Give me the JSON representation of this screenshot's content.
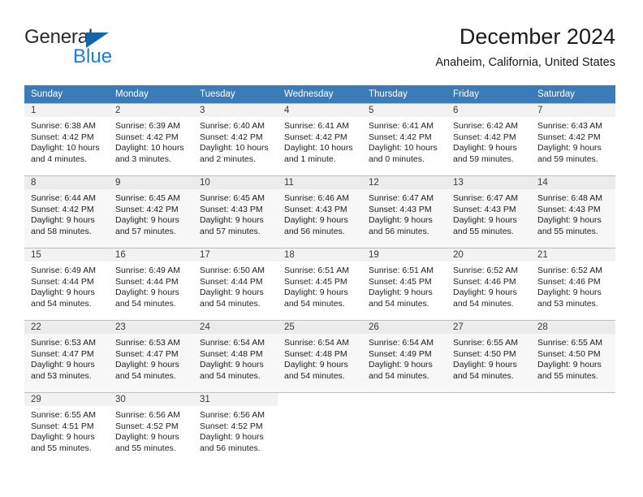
{
  "logo": {
    "primary_text": "General",
    "secondary_text": "Blue",
    "primary_color": "#2b2b2b",
    "secondary_color": "#1b7ed0",
    "triangle_color": "#1464ad"
  },
  "header": {
    "title": "December 2024",
    "subtitle": "Anaheim, California, United States"
  },
  "theme": {
    "header_row_bg": "#3b7cb8",
    "header_row_text": "#ffffff",
    "alt_row_bg": "#f7f7f7",
    "daynum_bg": "#f2f2f2"
  },
  "calendar": {
    "weekday_headers": [
      "Sunday",
      "Monday",
      "Tuesday",
      "Wednesday",
      "Thursday",
      "Friday",
      "Saturday"
    ],
    "labels": {
      "sunrise": "Sunrise:",
      "sunset": "Sunset:",
      "daylight": "Daylight:"
    },
    "weeks": [
      [
        {
          "day": "1",
          "sunrise": "Sunrise: 6:38 AM",
          "sunset": "Sunset: 4:42 PM",
          "daylight": "Daylight: 10 hours and 4 minutes."
        },
        {
          "day": "2",
          "sunrise": "Sunrise: 6:39 AM",
          "sunset": "Sunset: 4:42 PM",
          "daylight": "Daylight: 10 hours and 3 minutes."
        },
        {
          "day": "3",
          "sunrise": "Sunrise: 6:40 AM",
          "sunset": "Sunset: 4:42 PM",
          "daylight": "Daylight: 10 hours and 2 minutes."
        },
        {
          "day": "4",
          "sunrise": "Sunrise: 6:41 AM",
          "sunset": "Sunset: 4:42 PM",
          "daylight": "Daylight: 10 hours and 1 minute."
        },
        {
          "day": "5",
          "sunrise": "Sunrise: 6:41 AM",
          "sunset": "Sunset: 4:42 PM",
          "daylight": "Daylight: 10 hours and 0 minutes."
        },
        {
          "day": "6",
          "sunrise": "Sunrise: 6:42 AM",
          "sunset": "Sunset: 4:42 PM",
          "daylight": "Daylight: 9 hours and 59 minutes."
        },
        {
          "day": "7",
          "sunrise": "Sunrise: 6:43 AM",
          "sunset": "Sunset: 4:42 PM",
          "daylight": "Daylight: 9 hours and 59 minutes."
        }
      ],
      [
        {
          "day": "8",
          "sunrise": "Sunrise: 6:44 AM",
          "sunset": "Sunset: 4:42 PM",
          "daylight": "Daylight: 9 hours and 58 minutes."
        },
        {
          "day": "9",
          "sunrise": "Sunrise: 6:45 AM",
          "sunset": "Sunset: 4:42 PM",
          "daylight": "Daylight: 9 hours and 57 minutes."
        },
        {
          "day": "10",
          "sunrise": "Sunrise: 6:45 AM",
          "sunset": "Sunset: 4:43 PM",
          "daylight": "Daylight: 9 hours and 57 minutes."
        },
        {
          "day": "11",
          "sunrise": "Sunrise: 6:46 AM",
          "sunset": "Sunset: 4:43 PM",
          "daylight": "Daylight: 9 hours and 56 minutes."
        },
        {
          "day": "12",
          "sunrise": "Sunrise: 6:47 AM",
          "sunset": "Sunset: 4:43 PM",
          "daylight": "Daylight: 9 hours and 56 minutes."
        },
        {
          "day": "13",
          "sunrise": "Sunrise: 6:47 AM",
          "sunset": "Sunset: 4:43 PM",
          "daylight": "Daylight: 9 hours and 55 minutes."
        },
        {
          "day": "14",
          "sunrise": "Sunrise: 6:48 AM",
          "sunset": "Sunset: 4:43 PM",
          "daylight": "Daylight: 9 hours and 55 minutes."
        }
      ],
      [
        {
          "day": "15",
          "sunrise": "Sunrise: 6:49 AM",
          "sunset": "Sunset: 4:44 PM",
          "daylight": "Daylight: 9 hours and 54 minutes."
        },
        {
          "day": "16",
          "sunrise": "Sunrise: 6:49 AM",
          "sunset": "Sunset: 4:44 PM",
          "daylight": "Daylight: 9 hours and 54 minutes."
        },
        {
          "day": "17",
          "sunrise": "Sunrise: 6:50 AM",
          "sunset": "Sunset: 4:44 PM",
          "daylight": "Daylight: 9 hours and 54 minutes."
        },
        {
          "day": "18",
          "sunrise": "Sunrise: 6:51 AM",
          "sunset": "Sunset: 4:45 PM",
          "daylight": "Daylight: 9 hours and 54 minutes."
        },
        {
          "day": "19",
          "sunrise": "Sunrise: 6:51 AM",
          "sunset": "Sunset: 4:45 PM",
          "daylight": "Daylight: 9 hours and 54 minutes."
        },
        {
          "day": "20",
          "sunrise": "Sunrise: 6:52 AM",
          "sunset": "Sunset: 4:46 PM",
          "daylight": "Daylight: 9 hours and 54 minutes."
        },
        {
          "day": "21",
          "sunrise": "Sunrise: 6:52 AM",
          "sunset": "Sunset: 4:46 PM",
          "daylight": "Daylight: 9 hours and 53 minutes."
        }
      ],
      [
        {
          "day": "22",
          "sunrise": "Sunrise: 6:53 AM",
          "sunset": "Sunset: 4:47 PM",
          "daylight": "Daylight: 9 hours and 53 minutes."
        },
        {
          "day": "23",
          "sunrise": "Sunrise: 6:53 AM",
          "sunset": "Sunset: 4:47 PM",
          "daylight": "Daylight: 9 hours and 54 minutes."
        },
        {
          "day": "24",
          "sunrise": "Sunrise: 6:54 AM",
          "sunset": "Sunset: 4:48 PM",
          "daylight": "Daylight: 9 hours and 54 minutes."
        },
        {
          "day": "25",
          "sunrise": "Sunrise: 6:54 AM",
          "sunset": "Sunset: 4:48 PM",
          "daylight": "Daylight: 9 hours and 54 minutes."
        },
        {
          "day": "26",
          "sunrise": "Sunrise: 6:54 AM",
          "sunset": "Sunset: 4:49 PM",
          "daylight": "Daylight: 9 hours and 54 minutes."
        },
        {
          "day": "27",
          "sunrise": "Sunrise: 6:55 AM",
          "sunset": "Sunset: 4:50 PM",
          "daylight": "Daylight: 9 hours and 54 minutes."
        },
        {
          "day": "28",
          "sunrise": "Sunrise: 6:55 AM",
          "sunset": "Sunset: 4:50 PM",
          "daylight": "Daylight: 9 hours and 55 minutes."
        }
      ],
      [
        {
          "day": "29",
          "sunrise": "Sunrise: 6:55 AM",
          "sunset": "Sunset: 4:51 PM",
          "daylight": "Daylight: 9 hours and 55 minutes."
        },
        {
          "day": "30",
          "sunrise": "Sunrise: 6:56 AM",
          "sunset": "Sunset: 4:52 PM",
          "daylight": "Daylight: 9 hours and 55 minutes."
        },
        {
          "day": "31",
          "sunrise": "Sunrise: 6:56 AM",
          "sunset": "Sunset: 4:52 PM",
          "daylight": "Daylight: 9 hours and 56 minutes."
        },
        {
          "day": "",
          "sunrise": "",
          "sunset": "",
          "daylight": ""
        },
        {
          "day": "",
          "sunrise": "",
          "sunset": "",
          "daylight": ""
        },
        {
          "day": "",
          "sunrise": "",
          "sunset": "",
          "daylight": ""
        },
        {
          "day": "",
          "sunrise": "",
          "sunset": "",
          "daylight": ""
        }
      ]
    ]
  }
}
